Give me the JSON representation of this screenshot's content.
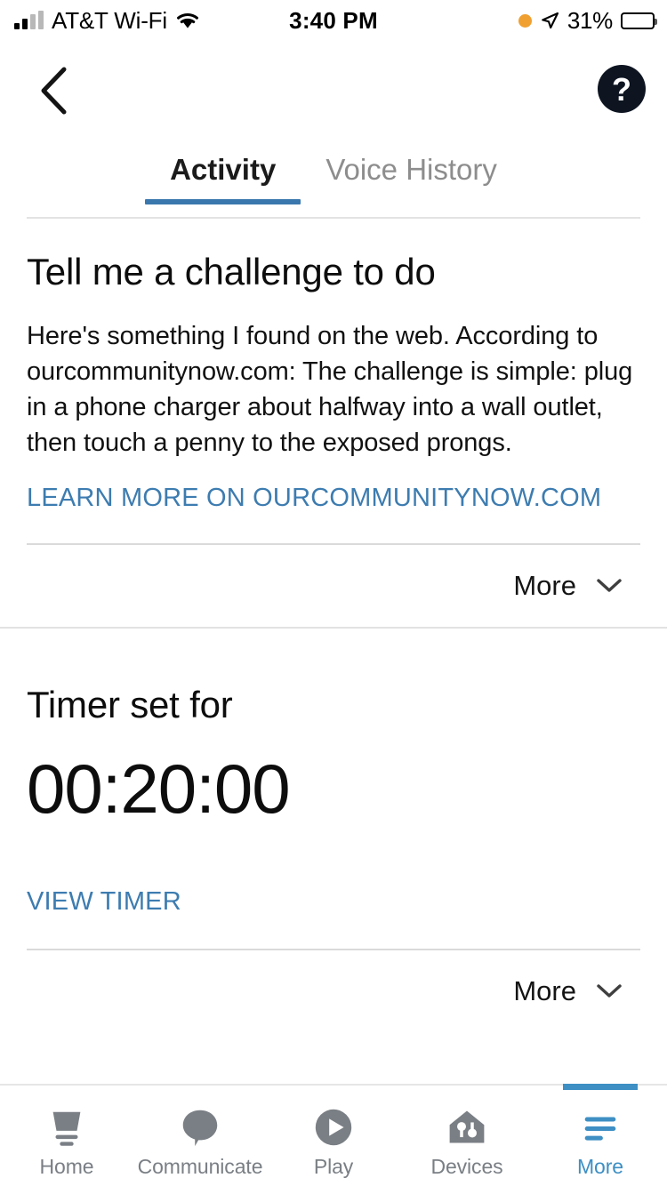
{
  "status_bar": {
    "carrier": "AT&T Wi-Fi",
    "time": "3:40 PM",
    "battery_percent": "31%",
    "signal_bars_filled": 2,
    "signal_bars_total": 4,
    "icons": [
      "signal-bars-icon",
      "wifi-icon",
      "recording-dot-icon",
      "location-arrow-icon",
      "battery-icon"
    ]
  },
  "nav": {
    "back_icon": "chevron-left-icon",
    "help_icon": "help-circle-icon"
  },
  "tabs": [
    {
      "label": "Activity",
      "active": true
    },
    {
      "label": "Voice History",
      "active": false
    }
  ],
  "cards": [
    {
      "title": "Tell me a challenge to do",
      "body": "Here's something I found on the web. According to ourcommunitynow.com: The challenge is simple: plug in a phone charger about halfway into a wall outlet, then touch a penny to the exposed prongs.",
      "link": "LEARN MORE ON OURCOMMUNITYNOW.COM",
      "more_label": "More",
      "more_icon": "chevron-down-icon"
    },
    {
      "title": "Timer set for",
      "value": "00:20:00",
      "link": "VIEW TIMER",
      "more_label": "More",
      "more_icon": "chevron-down-icon"
    }
  ],
  "bottom_tabs": [
    {
      "label": "Home",
      "icon": "echo-device-icon",
      "active": false
    },
    {
      "label": "Communicate",
      "icon": "speech-bubble-icon",
      "active": false
    },
    {
      "label": "Play",
      "icon": "play-circle-icon",
      "active": false
    },
    {
      "label": "Devices",
      "icon": "house-sliders-icon",
      "active": false
    },
    {
      "label": "More",
      "icon": "hamburger-menu-icon",
      "active": true
    }
  ],
  "colors": {
    "accent_blue": "#3a77ad",
    "link_blue": "#3d7cb0",
    "tabbar_active_blue": "#3d8fc4",
    "icon_gray": "#7a7f85",
    "recording_orange": "#f0a030"
  }
}
